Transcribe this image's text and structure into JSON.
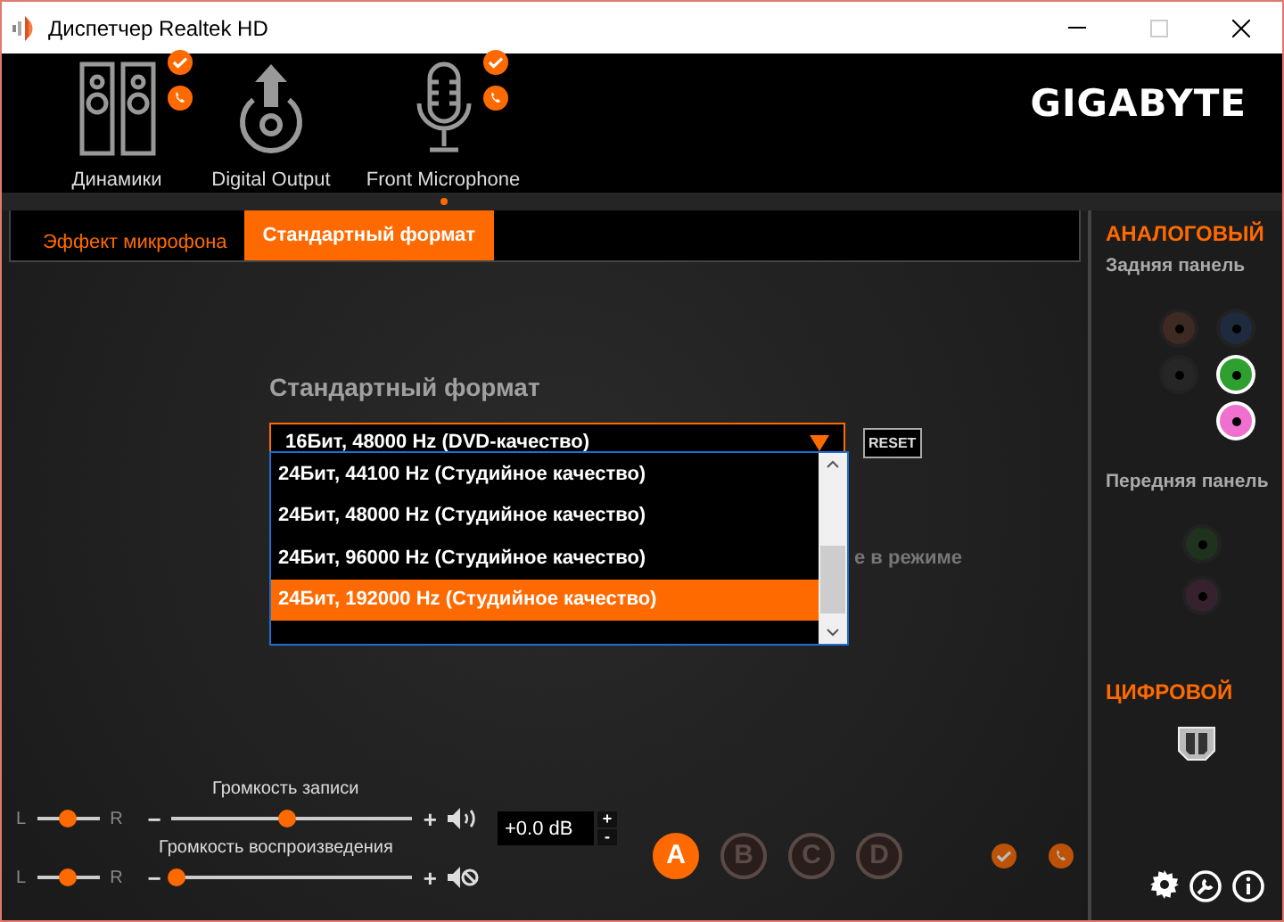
{
  "window": {
    "title": "Диспетчер Realtek HD"
  },
  "devices": [
    {
      "label": "Динамики",
      "kind": "speakers",
      "badges": true,
      "selected": false
    },
    {
      "label": "Digital Output",
      "kind": "digital",
      "badges": false,
      "selected": false
    },
    {
      "label": "Front Microphone",
      "kind": "microphone",
      "badges": true,
      "selected": true
    }
  ],
  "logo": "GIGABYTE",
  "tabs": [
    {
      "label": "Эффект микрофона",
      "selected": false
    },
    {
      "label": "Стандартный формат",
      "selected": true
    }
  ],
  "format": {
    "heading": "Стандартный формат",
    "value": "16Бит, 48000 Hz (DVD-качество)",
    "reset": "RESET",
    "behind_text": "е в режиме",
    "options": [
      {
        "label": "24Бит, 44100 Hz (Студийное качество)",
        "selected": false
      },
      {
        "label": "24Бит, 48000 Hz (Студийное качество)",
        "selected": false
      },
      {
        "label": "24Бит, 96000 Hz (Студийное качество)",
        "selected": false
      },
      {
        "label": "24Бит, 192000 Hz (Студийное качество)",
        "selected": true
      }
    ]
  },
  "volumes": [
    {
      "label": "Громкость записи",
      "left": "L",
      "right": "R",
      "minus": "−",
      "plus": "+",
      "balance": {
        "level": 0.5
      },
      "level": 0.48,
      "muted": false
    },
    {
      "label": "Громкость воспроизведения",
      "left": "L",
      "right": "R",
      "minus": "−",
      "plus": "+",
      "balance": {
        "level": 0.5
      },
      "level": 0.02,
      "muted": true
    }
  ],
  "gain": {
    "value": "+0.0 dB",
    "up": "+",
    "down": "-"
  },
  "profiles": [
    {
      "label": "A",
      "selected": true
    },
    {
      "label": "B",
      "selected": false
    },
    {
      "label": "C",
      "selected": false
    },
    {
      "label": "D",
      "selected": false
    }
  ],
  "analog": {
    "title": "АНАЛОГОВЫЙ",
    "rear_label": "Задняя панель",
    "front_label": "Передняя панель",
    "rear_jacks": [
      {
        "color": "#3e2a22",
        "active": false
      },
      {
        "color": "#1e2a3e",
        "active": false
      },
      {
        "color": "#262626",
        "active": false
      },
      {
        "color": "#2fa02f",
        "active": true
      },
      {
        "color": "#f070d0",
        "active": true
      }
    ],
    "front_jacks": [
      {
        "color": "#1e321e",
        "active": false
      },
      {
        "color": "#36222e",
        "active": false
      }
    ]
  },
  "digital": {
    "title": "ЦИФРОВОЙ"
  }
}
